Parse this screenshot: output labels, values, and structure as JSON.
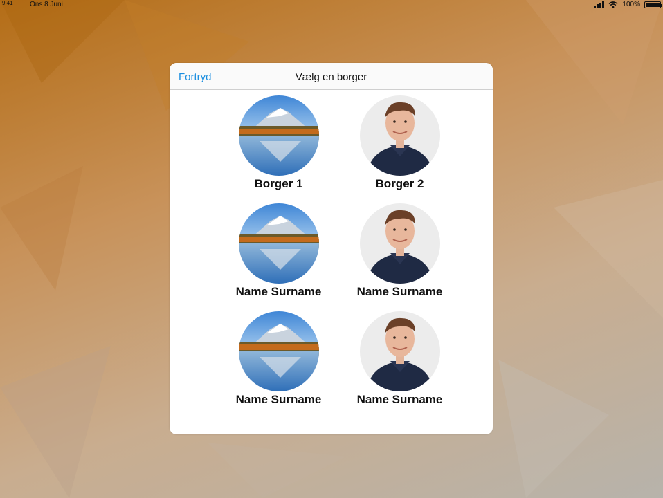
{
  "status_bar": {
    "time": "9:41",
    "date": "Ons 8 Juni",
    "battery": "100%"
  },
  "dialog": {
    "cancel_label": "Fortryd",
    "title": "Vælg en borger"
  },
  "people": [
    {
      "name": "Borger 1",
      "avatar": "mountain-lake-photo"
    },
    {
      "name": "Borger 2",
      "avatar": "man-portrait-photo"
    },
    {
      "name": "Name Surname",
      "avatar": "mountain-lake-photo"
    },
    {
      "name": "Name Surname",
      "avatar": "man-portrait-photo"
    },
    {
      "name": "Name Surname",
      "avatar": "mountain-lake-photo"
    },
    {
      "name": "Name Surname",
      "avatar": "man-portrait-photo"
    }
  ],
  "colors": {
    "accent": "#1a8ee0"
  }
}
